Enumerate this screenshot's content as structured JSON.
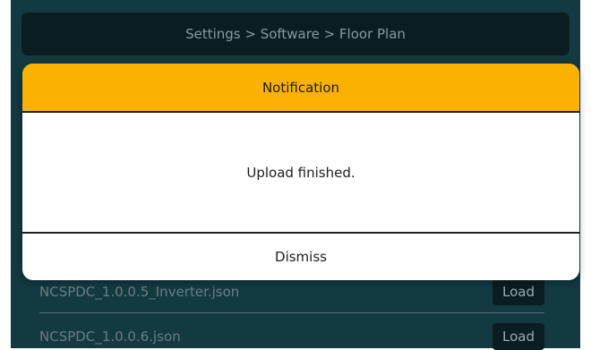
{
  "breadcrumb": "Settings > Software > Floor Plan",
  "files": [
    {
      "name": "NCSPDC_1.0.0.5_Inverter.json",
      "action": "Load"
    },
    {
      "name": "NCSPDC_1.0.0.6.json",
      "action": "Load"
    }
  ],
  "dialog": {
    "title": "Notification",
    "message": "Upload finished.",
    "dismiss_label": "Dismiss"
  },
  "colors": {
    "background": "#123a40",
    "header_accent": "#fbb100",
    "panel_dark": "#0a1e22"
  }
}
